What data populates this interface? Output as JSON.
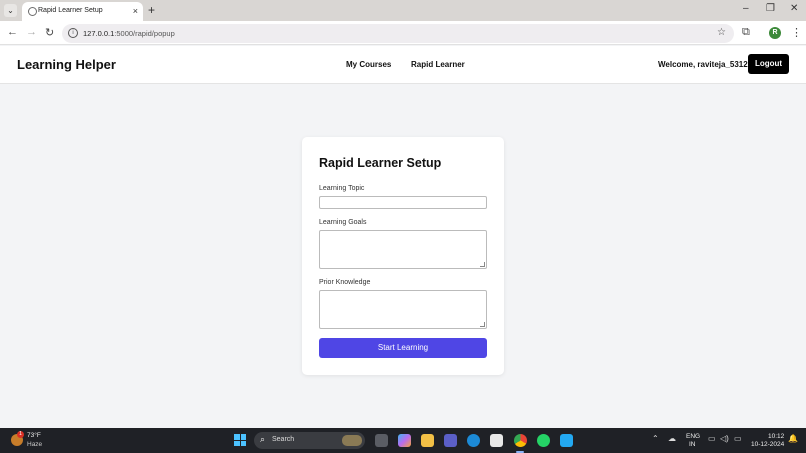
{
  "browser": {
    "tab_title": "Rapid Learner Setup",
    "tab_close": "×",
    "new_tab": "+",
    "url_host": "127.0.0.1",
    "url_path": ":5000/rapid/popup",
    "profile_initial": "R",
    "window_minimize": "–",
    "window_maximize": "❐",
    "window_close": "✕"
  },
  "header": {
    "brand": "Learning Helper",
    "nav": [
      "My Courses",
      "Rapid Learner"
    ],
    "welcome": "Welcome, raviteja_5312",
    "logout_label": "Logout"
  },
  "form": {
    "title": "Rapid Learner Setup",
    "topic_label": "Learning Topic",
    "topic_value": "",
    "goals_label": "Learning Goals",
    "goals_value": "",
    "prior_label": "Prior Knowledge",
    "prior_value": "",
    "submit_label": "Start Learning"
  },
  "taskbar": {
    "weather_temp": "73°F",
    "weather_condition": "Haze",
    "weather_badge": "1",
    "search_label": "Search",
    "language": "ENG",
    "region": "IN",
    "time": "10:12",
    "date": "10-12-2024"
  },
  "colors": {
    "accent": "#4f46e5",
    "logout_bg": "#000000"
  }
}
